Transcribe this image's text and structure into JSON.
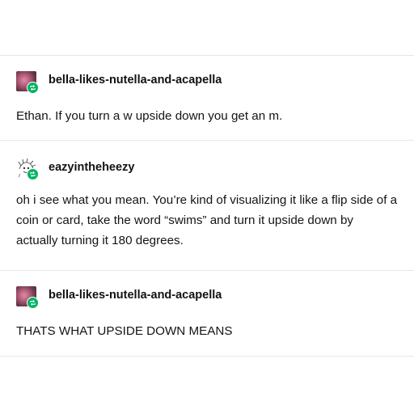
{
  "posts": [
    {
      "username": "bella-likes-nutella-and-acapella",
      "avatar_icon": "user-photo-avatar",
      "badge_icon": "reblog-icon",
      "text": "Ethan. If you turn a w upside down you get an m."
    },
    {
      "username": "eazyintheheezy",
      "avatar_icon": "sketch-avatar",
      "badge_icon": "reblog-icon",
      "text": "oh i see what you mean. You’re kind of visualizing it like a flip side of a coin or card, take the word “swims” and turn it upside down by actually turning it 180 degrees."
    },
    {
      "username": "bella-likes-nutella-and-acapella",
      "avatar_icon": "user-photo-avatar",
      "badge_icon": "reblog-icon",
      "text": "THATS WHAT UPSIDE DOWN MEANS"
    }
  ],
  "colors": {
    "reblog_green": "#00b362",
    "divider": "#e6e6e6",
    "text": "#141414"
  }
}
